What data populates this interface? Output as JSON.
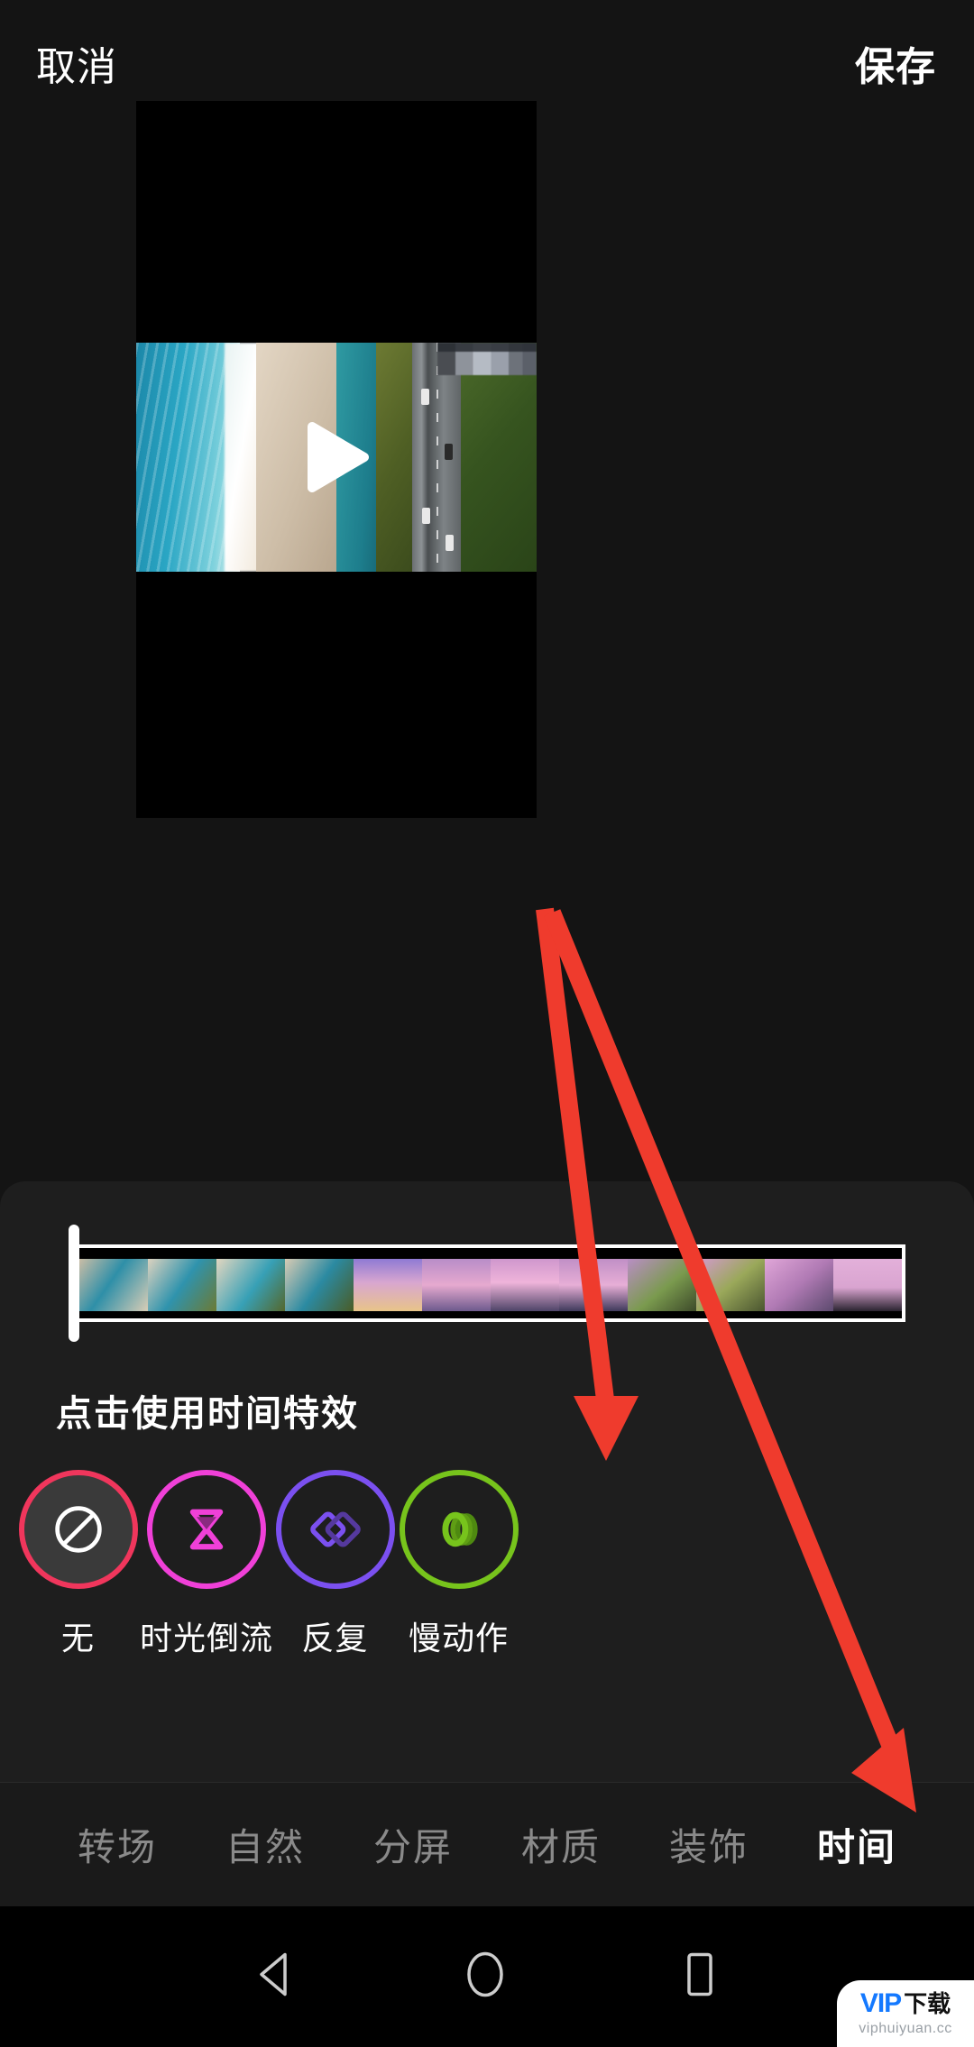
{
  "header": {
    "cancel_label": "取消",
    "save_label": "保存"
  },
  "preview": {
    "play_icon": "play-icon",
    "censor_patch": "mosaic-blur-patch"
  },
  "timeline": {
    "handle_icon": "trim-handle-left",
    "clip_count": 12
  },
  "hint": {
    "text": "点击使用时间特效"
  },
  "effects": {
    "items": [
      {
        "label": "无",
        "icon": "no-effect-icon",
        "ring_color": "#f0365c",
        "icon_color": "#ffffff",
        "selected": true
      },
      {
        "label": "时光倒流",
        "icon": "hourglass-icon",
        "ring_color": "#f040d8",
        "icon_color": "#f040d8",
        "selected": false
      },
      {
        "label": "反复",
        "icon": "double-diamond-icon",
        "ring_color": "#7b50f0",
        "icon_color": "#7b50f0",
        "selected": false
      },
      {
        "label": "慢动作",
        "icon": "slow-motion-icon",
        "ring_color": "#77c41c",
        "icon_color": "#77c41c",
        "selected": false
      }
    ]
  },
  "tabs": {
    "items": [
      {
        "label": "转场",
        "active": false
      },
      {
        "label": "自然",
        "active": false
      },
      {
        "label": "分屏",
        "active": false
      },
      {
        "label": "材质",
        "active": false
      },
      {
        "label": "装饰",
        "active": false
      },
      {
        "label": "时间",
        "active": true
      }
    ]
  },
  "navbar": {
    "back_icon": "triangle-back-icon",
    "home_icon": "circle-home-icon",
    "recents_icon": "square-recents-icon"
  },
  "watermark": {
    "vip": "VIP",
    "download": "下载",
    "site": "viphuiyuan.cc"
  },
  "annotations": {
    "color": "#ef3b2d",
    "arrow_1_target": "slow-motion-effect",
    "arrow_2_target": "time-tab"
  },
  "colors": {
    "background": "#141414",
    "sheet": "#1e1e1e",
    "tabbar": "#1a1a1a",
    "accent_red": "#f0365c",
    "accent_pink": "#f040d8",
    "accent_purple": "#7b50f0",
    "accent_green": "#77c41c",
    "annotation_red": "#ef3b2d"
  }
}
